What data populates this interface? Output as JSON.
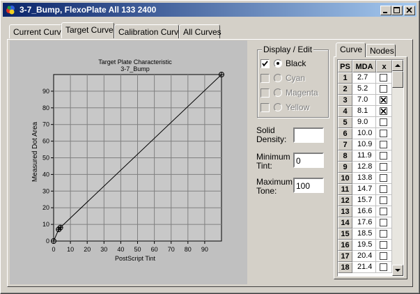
{
  "window": {
    "title": "3-7_Bump, FlexoPlate All 133 2400"
  },
  "tabs": [
    "Current Curve",
    "Target Curve",
    "Calibration Curve",
    "All Curves"
  ],
  "chart_data": {
    "type": "line",
    "title": "Target Plate Characteristic",
    "subtitle": "3-7_Bump",
    "xlabel": "PostScript Tint",
    "ylabel": "Measured Dot Area",
    "xlim": [
      0,
      100
    ],
    "ylim": [
      0,
      100
    ],
    "xticks": [
      0,
      10,
      20,
      30,
      40,
      50,
      60,
      70,
      80,
      90
    ],
    "yticks": [
      0,
      10,
      20,
      30,
      40,
      50,
      60,
      70,
      80,
      90
    ],
    "grid": true,
    "series": [
      {
        "x": [
          0,
          3,
          4,
          100
        ],
        "y": [
          0,
          7,
          8.1,
          100
        ]
      }
    ],
    "markers": [
      {
        "x": 0,
        "y": 0
      },
      {
        "x": 3,
        "y": 7
      },
      {
        "x": 4,
        "y": 8.1
      },
      {
        "x": 100,
        "y": 100
      }
    ]
  },
  "display_edit": {
    "legend": "Display / Edit",
    "channels": [
      {
        "label": "Black",
        "checked": true,
        "selected": true,
        "enabled": true
      },
      {
        "label": "Cyan",
        "checked": false,
        "selected": false,
        "enabled": false
      },
      {
        "label": "Magenta",
        "checked": false,
        "selected": false,
        "enabled": false
      },
      {
        "label": "Yellow",
        "checked": false,
        "selected": false,
        "enabled": false
      }
    ]
  },
  "fields": {
    "solid_density": {
      "label_1": "Solid",
      "label_2": "Density:",
      "value": ""
    },
    "minimum_tint": {
      "label_1": "Minimum",
      "label_2": "Tint:",
      "value": "0"
    },
    "maximum_tone": {
      "label_1": "Maximum",
      "label_2": "Tone:",
      "value": "100"
    }
  },
  "subtabs": [
    "Curve",
    "Nodes"
  ],
  "curve_table": {
    "headers": [
      "PS",
      "MDA",
      "x"
    ],
    "rows": [
      {
        "ps": "1",
        "mda": "2.7",
        "x": false
      },
      {
        "ps": "2",
        "mda": "5.2",
        "x": false
      },
      {
        "ps": "3",
        "mda": "7.0",
        "x": true
      },
      {
        "ps": "4",
        "mda": "8.1",
        "x": true
      },
      {
        "ps": "5",
        "mda": "9.0",
        "x": false
      },
      {
        "ps": "6",
        "mda": "10.0",
        "x": false
      },
      {
        "ps": "7",
        "mda": "10.9",
        "x": false
      },
      {
        "ps": "8",
        "mda": "11.9",
        "x": false
      },
      {
        "ps": "9",
        "mda": "12.8",
        "x": false
      },
      {
        "ps": "10",
        "mda": "13.8",
        "x": false
      },
      {
        "ps": "11",
        "mda": "14.7",
        "x": false
      },
      {
        "ps": "12",
        "mda": "15.7",
        "x": false
      },
      {
        "ps": "13",
        "mda": "16.6",
        "x": false
      },
      {
        "ps": "14",
        "mda": "17.6",
        "x": false
      },
      {
        "ps": "15",
        "mda": "18.5",
        "x": false
      },
      {
        "ps": "16",
        "mda": "19.5",
        "x": false
      },
      {
        "ps": "17",
        "mda": "20.4",
        "x": false
      },
      {
        "ps": "18",
        "mda": "21.4",
        "x": false
      }
    ]
  }
}
